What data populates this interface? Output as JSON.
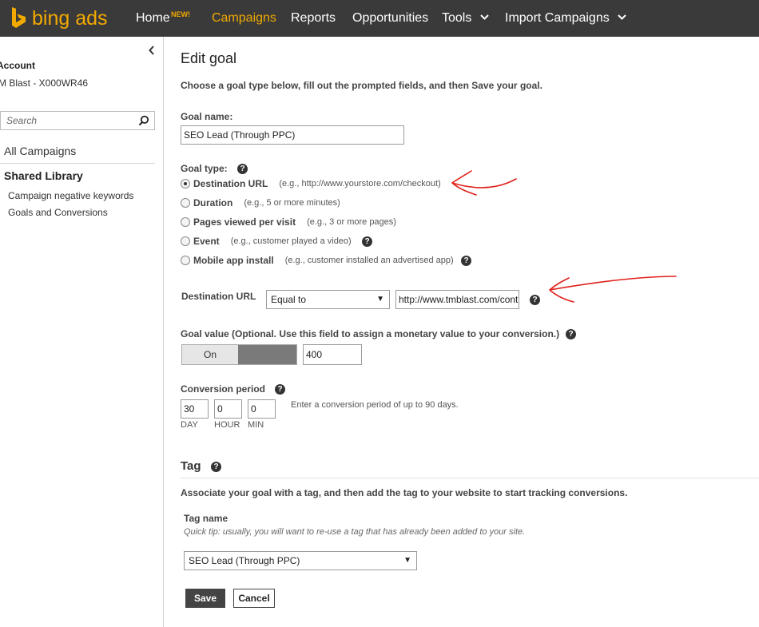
{
  "nav": {
    "logo_text": "bing ads",
    "items": [
      {
        "label": "Home",
        "badge": "NEW!"
      },
      {
        "label": "Campaigns"
      },
      {
        "label": "Reports"
      },
      {
        "label": "Opportunities"
      },
      {
        "label": "Tools"
      },
      {
        "label": "Import Campaigns"
      }
    ],
    "colors": {
      "bar": "#3a3a3a",
      "accent": "#f2a900",
      "text": "#ffffff"
    }
  },
  "sidebar": {
    "account_label": "Account",
    "account_name": "M Blast - X000WR46",
    "search_placeholder": "Search",
    "all_campaigns": "All Campaigns",
    "shared_library": "Shared Library",
    "links": [
      "Campaign negative keywords",
      "Goals and Conversions"
    ]
  },
  "main": {
    "title": "Edit goal",
    "intro": "Choose a goal type below, fill out the prompted fields, and then Save your goal.",
    "goal_name": {
      "label": "Goal name:",
      "value": "SEO Lead (Through PPC)"
    },
    "goal_type": {
      "label": "Goal type:",
      "options": [
        {
          "label": "Destination URL",
          "hint": "(e.g., http://www.yourstore.com/checkout)",
          "checked": true
        },
        {
          "label": "Duration",
          "hint": "(e.g., 5 or more minutes)",
          "checked": false
        },
        {
          "label": "Pages viewed per visit",
          "hint": "(e.g., 3 or more pages)",
          "checked": false
        },
        {
          "label": "Event",
          "hint": "(e.g., customer played a video)",
          "checked": false
        },
        {
          "label": "Mobile app install",
          "hint": "(e.g., customer installed an advertised app)",
          "checked": false
        }
      ]
    },
    "destination_url": {
      "label": "Destination URL",
      "operator": "Equal to",
      "value": "http://www.tmblast.com/cont"
    },
    "goal_value": {
      "label": "Goal value (Optional. Use this field to assign a monetary value to your conversion.)",
      "toggle": "On",
      "value": "400"
    },
    "conversion_period": {
      "label": "Conversion period",
      "day": "30",
      "hour": "0",
      "min": "0",
      "day_label": "DAY",
      "hour_label": "HOUR",
      "min_label": "MIN",
      "hint": "Enter a conversion period of up to 90 days."
    },
    "tag": {
      "section_title": "Tag",
      "description": "Associate your goal with a tag, and then add the tag to your website to start tracking conversions.",
      "name_label": "Tag name",
      "tip": "Quick tip: usually, you will want to re-use a tag that has already been added to your site.",
      "selected": "SEO Lead (Through PPC)"
    },
    "buttons": {
      "save": "Save",
      "cancel": "Cancel"
    },
    "help_glyph": "?"
  },
  "annotation_color": "#e0201b"
}
